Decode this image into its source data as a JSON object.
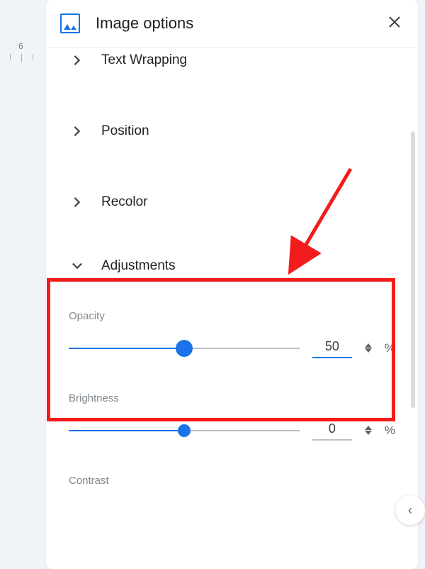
{
  "header": {
    "title": "Image options",
    "close_label": "×"
  },
  "ruler": {
    "num": "6"
  },
  "sections": {
    "text_wrapping": "Text Wrapping",
    "position": "Position",
    "recolor": "Recolor",
    "adjustments": "Adjustments"
  },
  "adjustments": {
    "opacity": {
      "label": "Opacity",
      "value": "50",
      "percent": 50,
      "unit": "%"
    },
    "brightness": {
      "label": "Brightness",
      "value": "0",
      "percent": 50,
      "unit": "%"
    },
    "contrast": {
      "label": "Contrast"
    }
  },
  "float": {
    "label": "‹"
  }
}
